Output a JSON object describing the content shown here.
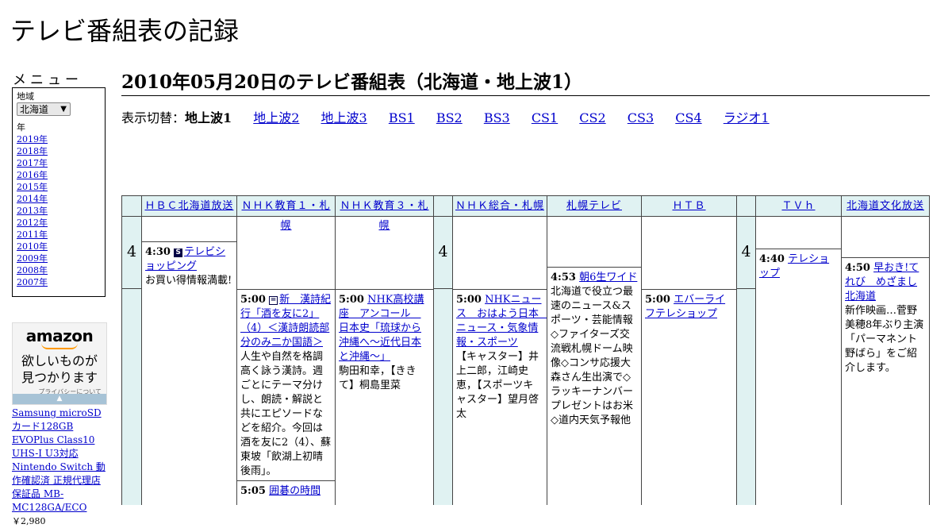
{
  "site_title": "テレビ番組表の記録",
  "menu": {
    "title": "メニュー",
    "region_label": "地域",
    "region_value": "北海道",
    "year_label": "年",
    "years": [
      "2019年",
      "2018年",
      "2017年",
      "2016年",
      "2015年",
      "2014年",
      "2013年",
      "2012年",
      "2011年",
      "2010年",
      "2009年",
      "2008年",
      "2007年"
    ]
  },
  "ad": {
    "logo": "amazon",
    "text1": "欲しいものが",
    "text2": "見つかります",
    "privacy": "プライバシーについて",
    "product": "Samsung microSDカード128GB EVOPlus Class10 UHS-I U3対応 Nintendo Switch 動作確認済 正規代理店保証品 MB-MC128GA/ECO",
    "price": "￥2,980"
  },
  "page_heading": "2010年05月20日のテレビ番組表（北海道・地上波1）",
  "switcher": {
    "label": "表示切替：",
    "current": "地上波1",
    "links": [
      "地上波2",
      "地上波3",
      "BS1",
      "BS2",
      "BS3",
      "CS1",
      "CS2",
      "CS3",
      "CS4",
      "ラジオ1"
    ]
  },
  "hour": "4",
  "channels": [
    {
      "name": "ＨＢＣ北海道放送",
      "programs": [
        {
          "time": "4:30",
          "marker": "S",
          "title": "テレビショッピング",
          "desc": "お買い得情報満載!"
        }
      ]
    },
    {
      "name": "ＮＨＫ教育１・札幌",
      "programs": [
        {
          "time": "5:00",
          "marker": "=",
          "title": "新　漢詩紀行「酒を友に2」（4）＜漢詩朗読部分のみ二か国語＞",
          "desc": "人生や自然を格調高く詠う漢詩。週ごとにテーマ分けし、朗読・解説と共にエピソードなどを紹介。今回は酒を友に2（4）、蘇東坡「飲湖上初晴後雨」。"
        },
        {
          "time": "5:05",
          "marker": "",
          "title": "囲碁の時間",
          "desc": ""
        }
      ]
    },
    {
      "name": "ＮＨＫ教育３・札幌",
      "programs": [
        {
          "time": "5:00",
          "marker": "",
          "title": "NHK高校講座　アンコール　日本史「琉球から沖縄へ～近代日本と沖縄～」",
          "desc": "駒田和幸，【ききて】桐島里菜"
        }
      ]
    },
    {
      "name": "ＮＨＫ総合・札幌",
      "programs": [
        {
          "time": "5:00",
          "marker": "",
          "title": "NHKニュース　おはよう日本　ニュース・気象情報・スポーツ",
          "desc": "【キャスター】井上二郎，江崎史恵，【スポーツキャスター】望月啓太"
        }
      ]
    },
    {
      "name": "札幌テレビ",
      "programs": [
        {
          "time": "4:53",
          "marker": "",
          "title": "朝6生ワイド",
          "desc": "北海道で役立つ最速のニュース&スポーツ・芸能情報◇ファイターズ交流戦札幌ドーム映像◇コンサ応援大森さん生出演で◇ラッキーナンバープレゼントはお米◇道内天気予報他"
        }
      ]
    },
    {
      "name": "ＨＴＢ",
      "programs": [
        {
          "time": "5:00",
          "marker": "",
          "title": "エバーライフテレショップ",
          "desc": ""
        }
      ]
    },
    {
      "name": "ＴＶｈ",
      "programs": [
        {
          "time": "4:40",
          "marker": "",
          "title": "テレショップ",
          "desc": ""
        }
      ]
    },
    {
      "name": "北海道文化放送",
      "programs": [
        {
          "time": "4:50",
          "marker": "",
          "title": "早おき!てれび　めざまし北海道",
          "desc": "新作映画…菅野美穂8年ぶり主演「パーマネント野ばら」をご紹介します。"
        }
      ]
    }
  ]
}
